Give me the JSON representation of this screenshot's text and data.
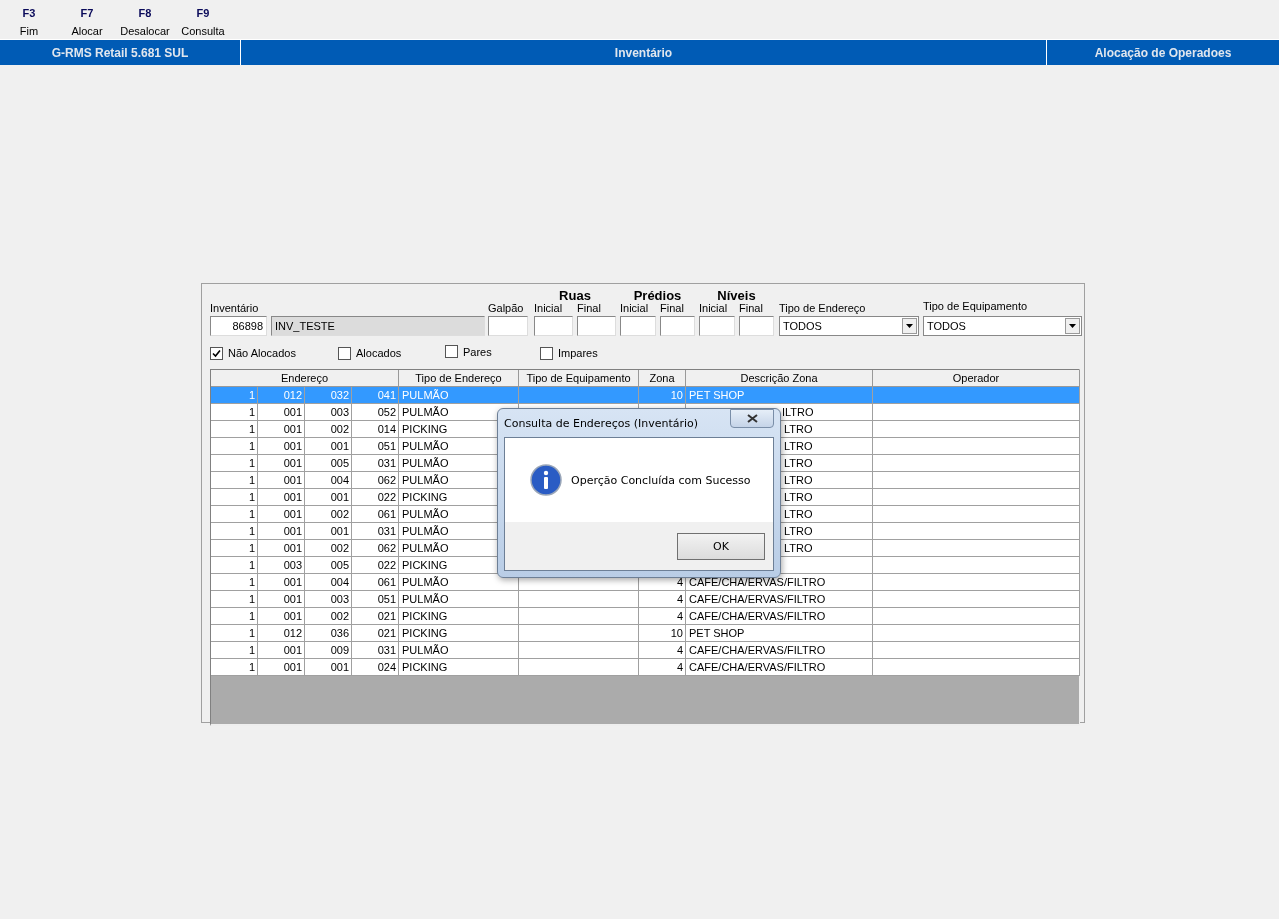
{
  "toolbar": [
    {
      "key": "F3",
      "label": "Fim"
    },
    {
      "key": "F7",
      "label": "Alocar"
    },
    {
      "key": "F8",
      "label": "Desalocar"
    },
    {
      "key": "F9",
      "label": "Consulta"
    }
  ],
  "header_bar": {
    "app": "G-RMS Retail 5.681 SUL",
    "module": "Inventário",
    "screen": "Alocação de Operadoes"
  },
  "form": {
    "inventory": {
      "label": "Inventário",
      "code": "86898",
      "name": "INV_TESTE"
    },
    "galpao": {
      "label": "Galpão"
    },
    "ranges": [
      {
        "title": "Ruas",
        "from": "Inicial",
        "to": "Final"
      },
      {
        "title": "Prédios",
        "from": "Inicial",
        "to": "Final"
      },
      {
        "title": "Níveis",
        "from": "Inicial",
        "to": "Final"
      }
    ],
    "address_type": {
      "label": "Tipo de Endereço",
      "value": "TODOS"
    },
    "equipment_type": {
      "label": "Tipo de Equipamento",
      "value": "TODOS"
    },
    "filters": [
      {
        "label": "Não Alocados",
        "checked": true
      },
      {
        "label": "Alocados",
        "checked": false
      },
      {
        "label": "Pares",
        "checked": false
      },
      {
        "label": "Impares",
        "checked": false
      }
    ]
  },
  "table": {
    "columns": [
      "Endereço",
      "Tipo de Endereço",
      "Tipo de Equipamento",
      "Zona",
      "Descrição Zona",
      "Operador"
    ],
    "rows": [
      {
        "selected": true,
        "kind": "full",
        "address": [
          "1",
          "012",
          "032",
          "041"
        ],
        "type": "PULMÃO",
        "zone": "10",
        "description": "PET SHOP"
      },
      {
        "selected": false,
        "kind": "covered",
        "address": [
          "1",
          "001",
          "003",
          "052"
        ],
        "type": "PULMÃO",
        "description": "ILTRO"
      },
      {
        "selected": false,
        "kind": "covered",
        "address": [
          "1",
          "001",
          "002",
          "014"
        ],
        "type": "PICKING",
        "description": "LTRO"
      },
      {
        "selected": false,
        "kind": "covered",
        "address": [
          "1",
          "001",
          "001",
          "051"
        ],
        "type": "PULMÃO",
        "description": "LTRO"
      },
      {
        "selected": false,
        "kind": "covered",
        "address": [
          "1",
          "001",
          "005",
          "031"
        ],
        "type": "PULMÃO",
        "description": "LTRO"
      },
      {
        "selected": false,
        "kind": "covered",
        "address": [
          "1",
          "001",
          "004",
          "062"
        ],
        "type": "PULMÃO",
        "description": "LTRO"
      },
      {
        "selected": false,
        "kind": "covered",
        "address": [
          "1",
          "001",
          "001",
          "022"
        ],
        "type": "PICKING",
        "description": "LTRO"
      },
      {
        "selected": false,
        "kind": "covered",
        "address": [
          "1",
          "001",
          "002",
          "061"
        ],
        "type": "PULMÃO",
        "description": "LTRO"
      },
      {
        "selected": false,
        "kind": "covered",
        "address": [
          "1",
          "001",
          "001",
          "031"
        ],
        "type": "PULMÃO",
        "description": "LTRO"
      },
      {
        "selected": false,
        "kind": "covered",
        "address": [
          "1",
          "001",
          "002",
          "062"
        ],
        "type": "PULMÃO",
        "description": "LTRO"
      },
      {
        "selected": false,
        "address": [
          "1",
          "003",
          "005",
          "022"
        ],
        "type": "PICKING"
      },
      {
        "selected": false,
        "kind": "full",
        "address": [
          "1",
          "001",
          "004",
          "061"
        ],
        "type": "PULMÃO",
        "zone": "4",
        "description": "CAFE/CHA/ERVAS/FILTRO"
      },
      {
        "selected": false,
        "kind": "full",
        "address": [
          "1",
          "001",
          "003",
          "051"
        ],
        "type": "PULMÃO",
        "zone": "4",
        "description": "CAFE/CHA/ERVAS/FILTRO"
      },
      {
        "selected": false,
        "kind": "full",
        "address": [
          "1",
          "001",
          "002",
          "021"
        ],
        "type": "PICKING",
        "zone": "4",
        "description": "CAFE/CHA/ERVAS/FILTRO"
      },
      {
        "selected": false,
        "kind": "full",
        "address": [
          "1",
          "012",
          "036",
          "021"
        ],
        "type": "PICKING",
        "zone": "10",
        "description": "PET SHOP"
      },
      {
        "selected": false,
        "kind": "full",
        "address": [
          "1",
          "001",
          "009",
          "031"
        ],
        "type": "PULMÃO",
        "zone": "4",
        "description": "CAFE/CHA/ERVAS/FILTRO"
      },
      {
        "selected": false,
        "kind": "full",
        "address": [
          "1",
          "001",
          "001",
          "024"
        ],
        "type": "PICKING",
        "zone": "4",
        "description": "CAFE/CHA/ERVAS/FILTRO"
      }
    ]
  },
  "dialog": {
    "title": "Consulta de Endereços (Inventário)",
    "message": "Operção Concluída com Sucesso",
    "button": "OK"
  }
}
